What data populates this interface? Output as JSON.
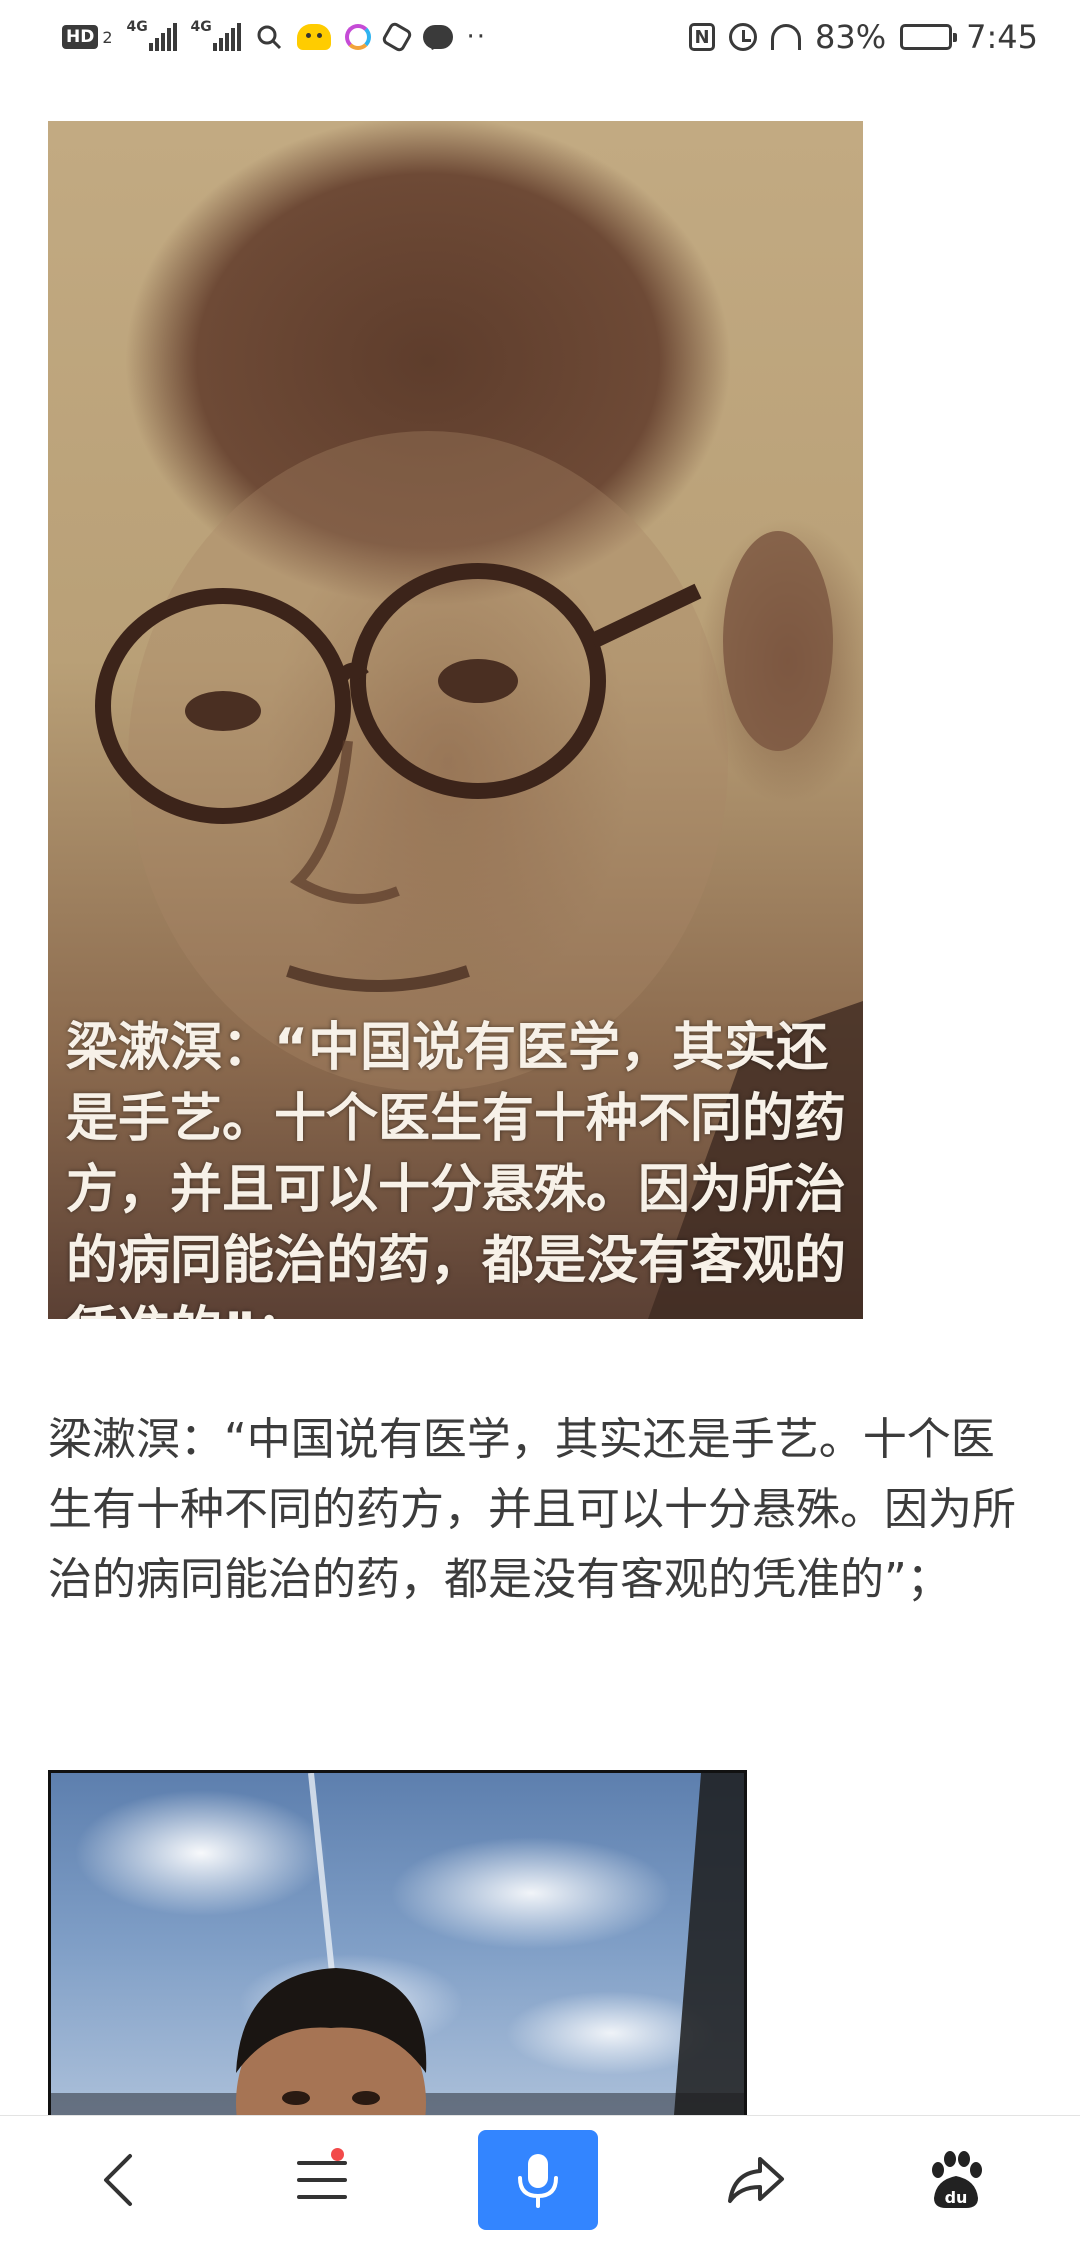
{
  "status_bar": {
    "hd_label": "HD",
    "hd_sub": "2",
    "sim1_tag": "4G",
    "sim2_tag": "4G",
    "nfc_label": "N",
    "battery_text": "83%",
    "battery_level": 0.83,
    "time": "7:45"
  },
  "article": {
    "image1_caption": "梁漱溟：“中国说有医学，其实还是手艺。十个医生有十种不同的药方，并且可以十分悬殊。因为所治的病同能治的药，都是没有客观的凭准的”；",
    "paragraph": "梁漱溟：“中国说有医学，其实还是手艺。十个医生有十种不同的药方，并且可以十分悬殊。因为所治的病同能治的药，都是没有客观的凭准的”；"
  },
  "bottom_bar": {
    "icons": [
      "back-icon",
      "menu-icon",
      "microphone-icon",
      "share-icon",
      "baidu-paw-icon"
    ],
    "baidu_label": "du",
    "accent_color": "#3385ff",
    "badge_color": "#f24a4a"
  }
}
